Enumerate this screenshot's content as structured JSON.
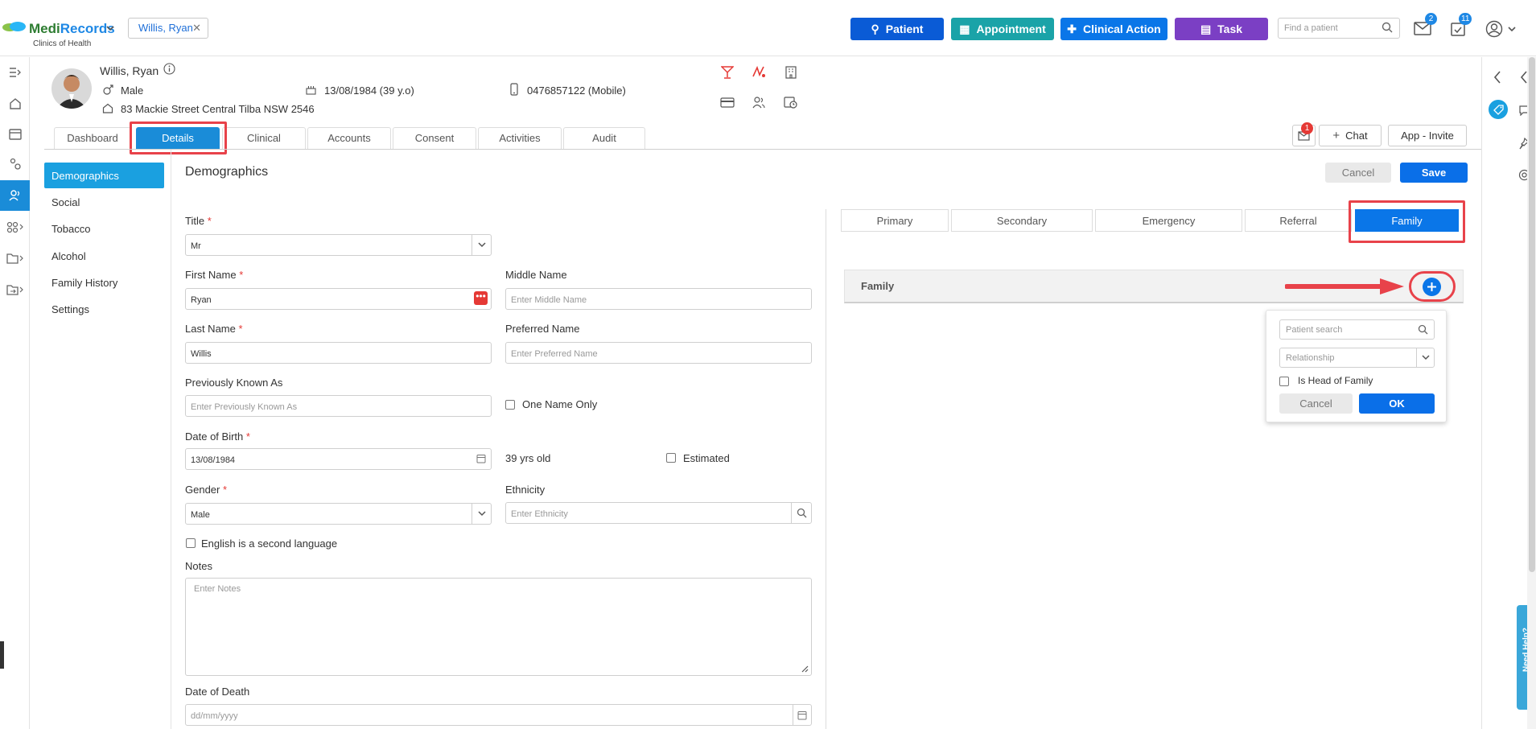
{
  "app": {
    "brand_part1": "Medi",
    "brand_part2": "Records",
    "subtitle": "Clinics of Health",
    "patient_chip": "Willis, Ryan"
  },
  "top_actions": {
    "patient": "Patient",
    "appointment": "Appointment",
    "clinical_action": "Clinical Action",
    "task": "Task",
    "search_placeholder": "Find a patient",
    "mail_badge": "2",
    "tasks_badge": "11"
  },
  "colors": {
    "patient_btn": "#0a5bd6",
    "appointment_btn": "#1aa3a8",
    "clinical_btn": "#0a76e8",
    "task_btn": "#7b3fc4",
    "highlight": "#e8424a",
    "accent": "#1a8cd8"
  },
  "patient": {
    "name": "Willis, Ryan",
    "gender": "Male",
    "dob": "13/08/1984 (39 y.o)",
    "phone": "0476857122 (Mobile)",
    "address": "83 Mackie Street Central Tilba NSW 2546"
  },
  "tabs": [
    "Dashboard",
    "Details",
    "Clinical",
    "Accounts",
    "Consent",
    "Activities",
    "Audit"
  ],
  "header_actions": {
    "notif_badge": "1",
    "chat": "Chat",
    "app_invite": "App - Invite"
  },
  "sidenav": [
    "Demographics",
    "Social",
    "Tobacco",
    "Alcohol",
    "Family History",
    "Settings"
  ],
  "section_title": "Demographics",
  "form_buttons": {
    "cancel": "Cancel",
    "save": "Save"
  },
  "form": {
    "title_label": "Title",
    "title_value": "Mr",
    "first_name_label": "First Name",
    "first_name_value": "Ryan",
    "middle_name_label": "Middle Name",
    "middle_name_placeholder": "Enter Middle Name",
    "last_name_label": "Last Name",
    "last_name_value": "Willis",
    "preferred_name_label": "Preferred Name",
    "preferred_name_placeholder": "Enter Preferred Name",
    "prev_known_label": "Previously Known As",
    "prev_known_placeholder": "Enter Previously Known As",
    "one_name_only": "One Name Only",
    "dob_label": "Date of Birth",
    "dob_value": "13/08/1984",
    "age_text": "39 yrs old",
    "estimated": "Estimated",
    "gender_label": "Gender",
    "gender_value": "Male",
    "ethnicity_label": "Ethnicity",
    "ethnicity_placeholder": "Enter Ethnicity",
    "english_second": "English is a second language",
    "notes_label": "Notes",
    "notes_placeholder": "Enter Notes",
    "dod_label": "Date of Death",
    "dod_placeholder": "dd/mm/yyyy"
  },
  "contact_tabs": [
    "Primary",
    "Secondary",
    "Emergency",
    "Referral",
    "Family"
  ],
  "family_panel": {
    "title": "Family",
    "patient_search_placeholder": "Patient search",
    "relationship_placeholder": "Relationship",
    "head_of_family": "Is Head of Family",
    "cancel": "Cancel",
    "ok": "OK"
  },
  "help_tab": "Need Help?"
}
